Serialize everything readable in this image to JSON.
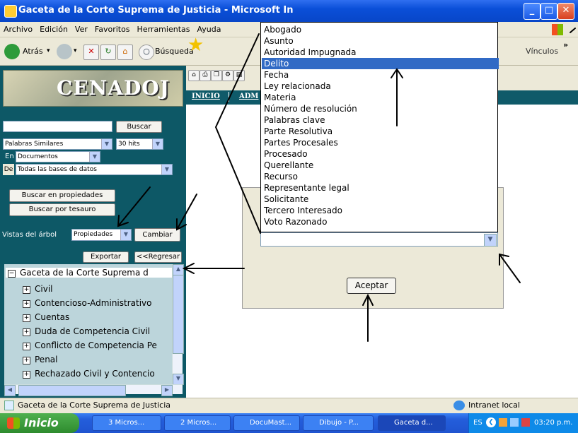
{
  "window": {
    "title": "Gaceta de la Corte Suprema de Justicia - Microsoft Internet Explorer",
    "title_visible": "Gaceta de la Corte Suprema de Justicia - Microsoft In"
  },
  "menu": [
    "Archivo",
    "Edición",
    "Ver",
    "Favoritos",
    "Herramientas",
    "Ayuda"
  ],
  "toolbar": {
    "back_label": "Atrás",
    "search_label": "Búsqueda",
    "links_label": "Vínculos"
  },
  "logo": {
    "text": "CENADOJ"
  },
  "left": {
    "search_button": "Buscar",
    "similar_select": "Palabras Similares",
    "hits_select": "30 hits",
    "en_label": "En",
    "en_select": "Documentos",
    "de_label": "De",
    "de_select": "Todas las bases de datos",
    "props_button": "Buscar en propiedades",
    "thesaurus_button": "Buscar por tesauro",
    "tree_view_label": "Vistas del árbol",
    "tree_view_select": "Propiedades",
    "change_button": "Cambiar",
    "export_button": "Exportar",
    "back_button": "<<Regresar",
    "tree_root": "Gaceta de la Corte Suprema d",
    "tree_items": [
      "Civil",
      "Contencioso-Administrativo",
      "Cuentas",
      "Duda de Competencia Civil",
      "Conflicto de Competencia Pe",
      "Penal",
      "Rechazado Civil y Contencio"
    ]
  },
  "nav": {
    "inicio": "INICIO",
    "adm": "ADM"
  },
  "dropdown": {
    "options": [
      "Abogado",
      "Asunto",
      "Autoridad Impugnada",
      "Delito",
      "Fecha",
      "Ley relacionada",
      "Materia",
      "Número de resolución",
      "Palabras clave",
      "Parte Resolutiva",
      "Partes Procesales",
      "Procesado",
      "Querellante",
      "Recurso",
      "Representante legal",
      "Solicitante",
      "Tercero Interesado",
      "Voto Razonado"
    ],
    "selected": "Delito"
  },
  "dialog": {
    "accept_button": "Aceptar"
  },
  "status": {
    "text": "Gaceta de la Corte Suprema de Justicia",
    "zone": "Intranet local"
  },
  "taskbar": {
    "start": "Inicio",
    "tasks": [
      "3 Micros...",
      "2 Micros...",
      "DocuMast...",
      "Dibujo - P...",
      "Gaceta d..."
    ],
    "lang": "ES",
    "clock": "03:20 p.m."
  },
  "colors": {
    "accent": "#316ac5",
    "left_pane": "#0d5866",
    "title_bar": "#0a4fd8"
  }
}
